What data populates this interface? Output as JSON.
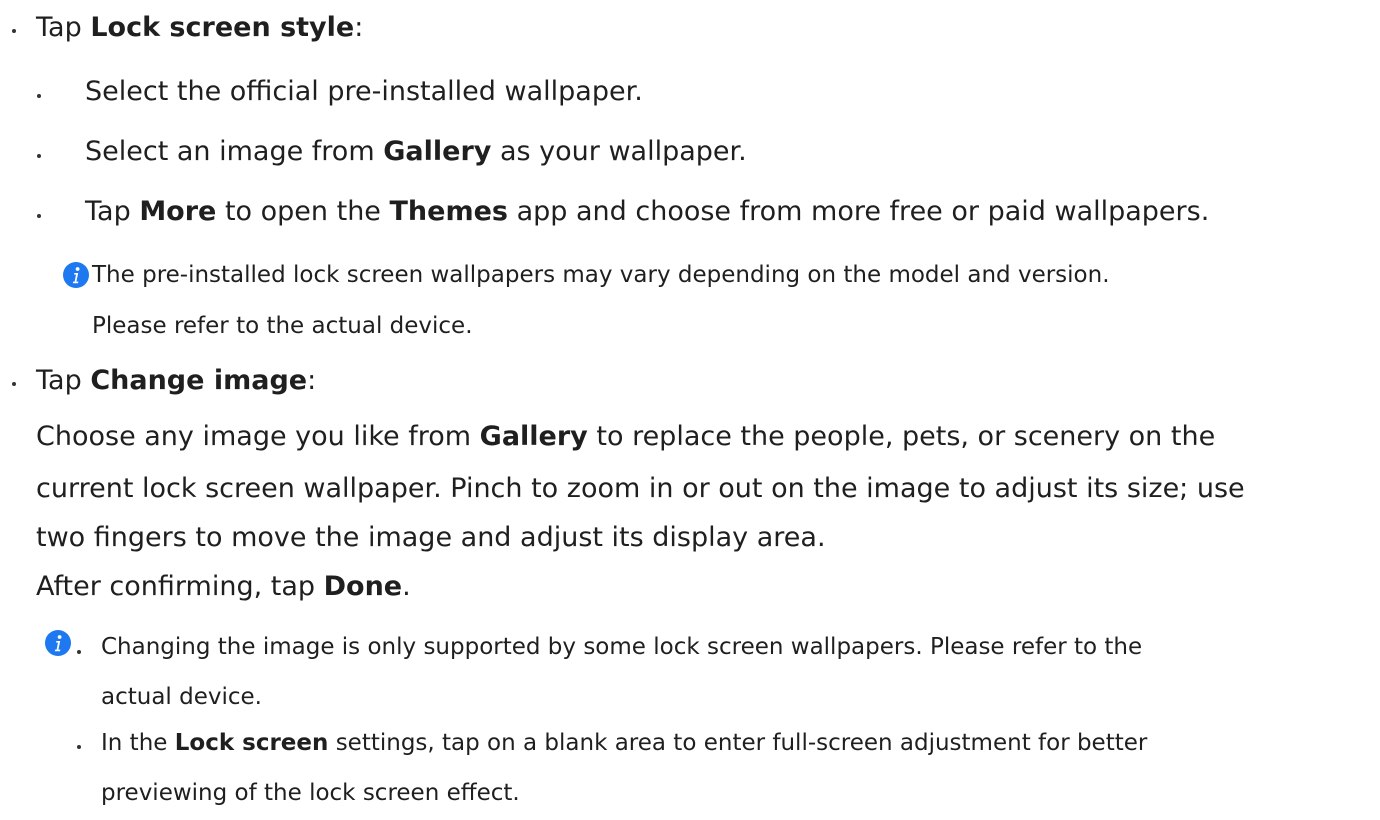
{
  "section1": {
    "tap": "Tap",
    "title": "Lock screen style",
    "colon": ":",
    "items": [
      {
        "a": "Select the official pre-installed wallpaper."
      },
      {
        "a": "Select an image from",
        "b": "Gallery",
        "c": "as your wallpaper."
      },
      {
        "a": "Tap",
        "b": "More",
        "c": "to open the",
        "d": "Themes",
        "e": "app and choose from more free or paid wallpapers."
      }
    ],
    "note": {
      "icon": "info-icon",
      "line1": "The pre-installed lock screen wallpapers may vary depending on the model and version.",
      "line2": "Please refer to the actual device."
    }
  },
  "section2": {
    "tap": "Tap",
    "title": "Change image",
    "colon": ":",
    "p1a": "Choose any image you like from",
    "p1b": "Gallery",
    "p1c": "to replace the people, pets, or scenery on the",
    "p2": "current lock screen wallpaper. Pinch to zoom in or out on the image to adjust its size; use",
    "p3": "two fingers to move the image and adjust its display area.",
    "p4a": "After confirming, tap",
    "p4b": "Done",
    "p4c": ".",
    "notes": {
      "icon": "info-icon",
      "n1l1": "Changing the image is only supported by some lock screen wallpapers. Please refer to the",
      "n1l2": "actual device.",
      "n2a": "In the",
      "n2b": "Lock screen",
      "n2c": "settings, tap on a blank area to enter full-screen adjustment for better",
      "n2l2": "previewing of the lock screen effect."
    }
  },
  "colors": {
    "text": "#1f1f1f",
    "accent": "#1e78f0"
  }
}
